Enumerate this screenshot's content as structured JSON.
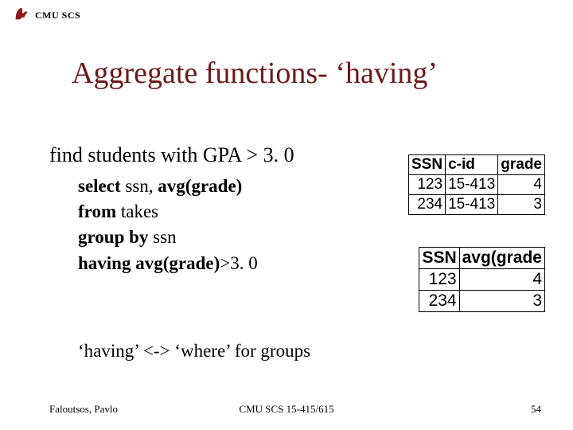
{
  "header": {
    "label": "CMU SCS"
  },
  "title": "Aggregate functions- ‘having’",
  "lead": "find students with GPA > 3. 0",
  "sql": {
    "l1_kw": "select",
    "l1_rest": " ssn, ",
    "l1_kw2": "avg(grade)",
    "l2_kw": "from",
    "l2_rest": " takes",
    "l3_kw": "group by",
    "l3_rest": " ssn",
    "l4_kw": "having",
    "l4_rest": " ",
    "l4_kw2": "avg(grade)",
    "l4_tail": ">3. 0"
  },
  "note": "‘having’ <-> ‘where’ for groups",
  "table1": {
    "headers": [
      "SSN",
      "c-id",
      "grade"
    ],
    "rows": [
      [
        "123",
        "15-413",
        "4"
      ],
      [
        "234",
        "15-413",
        "3"
      ]
    ]
  },
  "table2": {
    "headers": [
      "SSN",
      "avg(grade"
    ],
    "rows": [
      [
        "123",
        "4"
      ],
      [
        "234",
        "3"
      ]
    ]
  },
  "footer": {
    "left": "Faloutsos, Pavlo",
    "center": "CMU SCS 15-415/615",
    "right": "54"
  }
}
